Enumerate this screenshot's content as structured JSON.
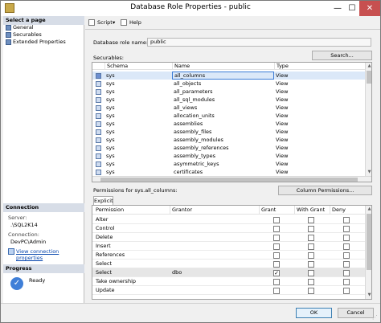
{
  "window": {
    "title": "Database Role Properties - public",
    "min_glyph": "—",
    "max_glyph": "☐",
    "close_glyph": "✕",
    "icon": "database-role-icon"
  },
  "left_pane": {
    "select_page_header": "Select a page",
    "pages": [
      {
        "label": "General",
        "icon": "page-icon"
      },
      {
        "label": "Securables",
        "icon": "page-icon"
      },
      {
        "label": "Extended Properties",
        "icon": "page-icon"
      }
    ],
    "connection_header": "Connection",
    "server_label": "Server:",
    "server_value": ".\\SQL2K14",
    "connection_label": "Connection:",
    "connection_value": "DevPC\\Admin",
    "view_connection_link": "View connection properties",
    "progress_header": "Progress",
    "progress_status": "Ready"
  },
  "toolbar": {
    "script_label": "Script",
    "script_dropdown_glyph": "▾",
    "help_label": "Help"
  },
  "form": {
    "role_name_label": "Database role name:",
    "role_name_value": "public",
    "securables_label": "Securables:",
    "search_button": "Search...",
    "permissions_label": "Permissions for sys.all_columns:",
    "column_permissions_button": "Column Permissions...",
    "explicit_tab": "Explicit"
  },
  "securables": {
    "columns": [
      "Schema",
      "Name",
      "Type"
    ],
    "rows": [
      {
        "schema": "sys",
        "name": "all_columns",
        "type": "View",
        "selected": true
      },
      {
        "schema": "sys",
        "name": "all_objects",
        "type": "View"
      },
      {
        "schema": "sys",
        "name": "all_parameters",
        "type": "View"
      },
      {
        "schema": "sys",
        "name": "all_sql_modules",
        "type": "View"
      },
      {
        "schema": "sys",
        "name": "all_views",
        "type": "View"
      },
      {
        "schema": "sys",
        "name": "allocation_units",
        "type": "View"
      },
      {
        "schema": "sys",
        "name": "assemblies",
        "type": "View"
      },
      {
        "schema": "sys",
        "name": "assembly_files",
        "type": "View"
      },
      {
        "schema": "sys",
        "name": "assembly_modules",
        "type": "View"
      },
      {
        "schema": "sys",
        "name": "assembly_references",
        "type": "View"
      },
      {
        "schema": "sys",
        "name": "assembly_types",
        "type": "View"
      },
      {
        "schema": "sys",
        "name": "asymmetric_keys",
        "type": "View"
      },
      {
        "schema": "sys",
        "name": "certificates",
        "type": "View"
      }
    ]
  },
  "permissions": {
    "columns": [
      "Permission",
      "Grantor",
      "Grant",
      "With Grant",
      "Deny"
    ],
    "rows": [
      {
        "permission": "Alter",
        "grantor": "",
        "grant": false,
        "with_grant": false,
        "deny": false
      },
      {
        "permission": "Control",
        "grantor": "",
        "grant": false,
        "with_grant": false,
        "deny": false
      },
      {
        "permission": "Delete",
        "grantor": "",
        "grant": false,
        "with_grant": false,
        "deny": false
      },
      {
        "permission": "Insert",
        "grantor": "",
        "grant": false,
        "with_grant": false,
        "deny": false
      },
      {
        "permission": "References",
        "grantor": "",
        "grant": false,
        "with_grant": false,
        "deny": false
      },
      {
        "permission": "Select",
        "grantor": "",
        "grant": false,
        "with_grant": false,
        "deny": false
      },
      {
        "permission": "Select",
        "grantor": "dbo",
        "grant": true,
        "with_grant": false,
        "deny": false,
        "selected": true
      },
      {
        "permission": "Take ownership",
        "grantor": "",
        "grant": false,
        "with_grant": false,
        "deny": false
      },
      {
        "permission": "Update",
        "grantor": "",
        "grant": false,
        "with_grant": false,
        "deny": false
      }
    ]
  },
  "footer": {
    "ok": "OK",
    "cancel": "Cancel",
    "grip_glyph": "⋰"
  },
  "check_glyph": "✓",
  "scroll_glyphs": {
    "up": "▲",
    "down": "▼"
  }
}
